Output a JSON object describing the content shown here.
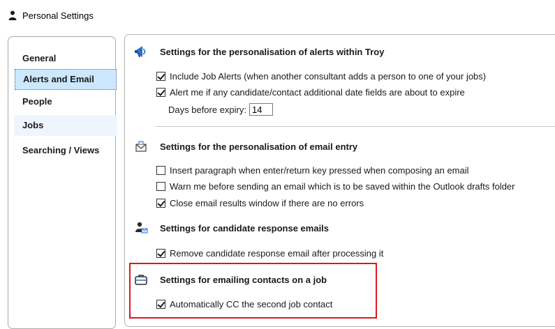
{
  "window": {
    "title": "Personal Settings",
    "icon": "person-icon"
  },
  "nav": {
    "items": [
      {
        "label": "General",
        "selected": false
      },
      {
        "label": "Alerts and Email",
        "selected": true
      },
      {
        "label": "People",
        "selected": false
      },
      {
        "label": "Jobs",
        "selected": false
      },
      {
        "label": "Searching / Views",
        "selected": false
      }
    ]
  },
  "sections": {
    "alerts": {
      "icon": "megaphone-icon",
      "heading": "Settings for the personalisation of alerts within Troy",
      "options": [
        {
          "label": "Include Job Alerts (when another consultant adds a person to one of your jobs)",
          "checked": true
        },
        {
          "label": "Alert me if any candidate/contact additional date fields are about to expire",
          "checked": true
        }
      ],
      "expiry_label": "Days before expiry:",
      "expiry_value": "14"
    },
    "email_entry": {
      "icon": "envelope-icon",
      "heading": "Settings for the personalisation of email entry",
      "options": [
        {
          "label": "Insert paragraph when enter/return key pressed when composing an email",
          "checked": false
        },
        {
          "label": "Warn me before sending an email which is to be saved within the Outlook drafts folder",
          "checked": false
        },
        {
          "label": "Close email results window if there are no errors",
          "checked": true
        }
      ]
    },
    "candidate_response": {
      "icon": "candidate-response-icon",
      "heading": "Settings for candidate response emails",
      "options": [
        {
          "label": "Remove candidate response email after processing it",
          "checked": true
        }
      ]
    },
    "job_contacts": {
      "icon": "briefcase-icon",
      "heading": "Settings for emailing contacts on a job",
      "options": [
        {
          "label": "Automatically CC the second job contact",
          "checked": true
        }
      ]
    }
  },
  "colors": {
    "selected_bg": "#cce8ff",
    "highlight": "#e0161b",
    "alt_bg": "#eef5fd"
  }
}
